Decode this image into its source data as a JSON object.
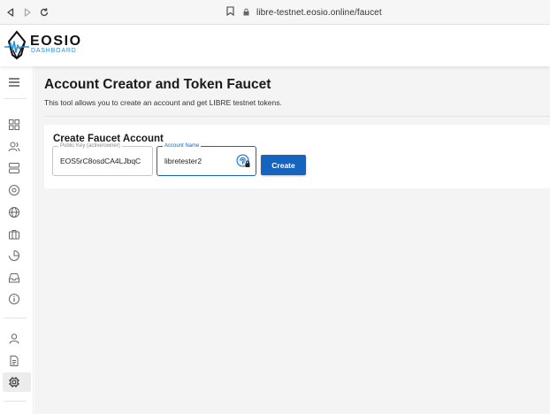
{
  "browser": {
    "url": "libre-testnet.eosio.online/faucet",
    "back_icon": "back-icon",
    "forward_icon": "forward-icon",
    "reload_icon": "reload-icon",
    "bookmark_icon": "bookmark-icon",
    "lock_icon": "lock-icon"
  },
  "header": {
    "logo_name": "EOSIO",
    "logo_sub": "DASHBOARD"
  },
  "sidebar": {
    "items": [
      {
        "icon": "menu-icon"
      },
      {
        "icon": "dashboard-grid-icon"
      },
      {
        "icon": "users-icon"
      },
      {
        "icon": "blocks-icon"
      },
      {
        "icon": "disc-icon"
      },
      {
        "icon": "globe-icon"
      },
      {
        "icon": "briefcase-icon"
      },
      {
        "icon": "pie-chart-icon"
      },
      {
        "icon": "inbox-icon"
      },
      {
        "icon": "info-icon"
      },
      {
        "icon": "account-icon"
      },
      {
        "icon": "document-icon"
      },
      {
        "icon": "faucet-chip-icon",
        "active": true
      }
    ]
  },
  "page": {
    "title": "Account Creator and Token Faucet",
    "description": "This tool allows you to create an account and get LIBRE testnet tokens."
  },
  "form": {
    "title": "Create Faucet Account",
    "public_key_label": "Public Key (active/owner)",
    "public_key_value": "EOS5rC8osdCA4LJbqC",
    "account_name_label": "Account Name",
    "account_name_value": "libretester2",
    "create_label": "Create"
  },
  "colors": {
    "accent": "#1565c0",
    "logo_blue": "#2a8fd8",
    "background": "#f4f4f4"
  }
}
